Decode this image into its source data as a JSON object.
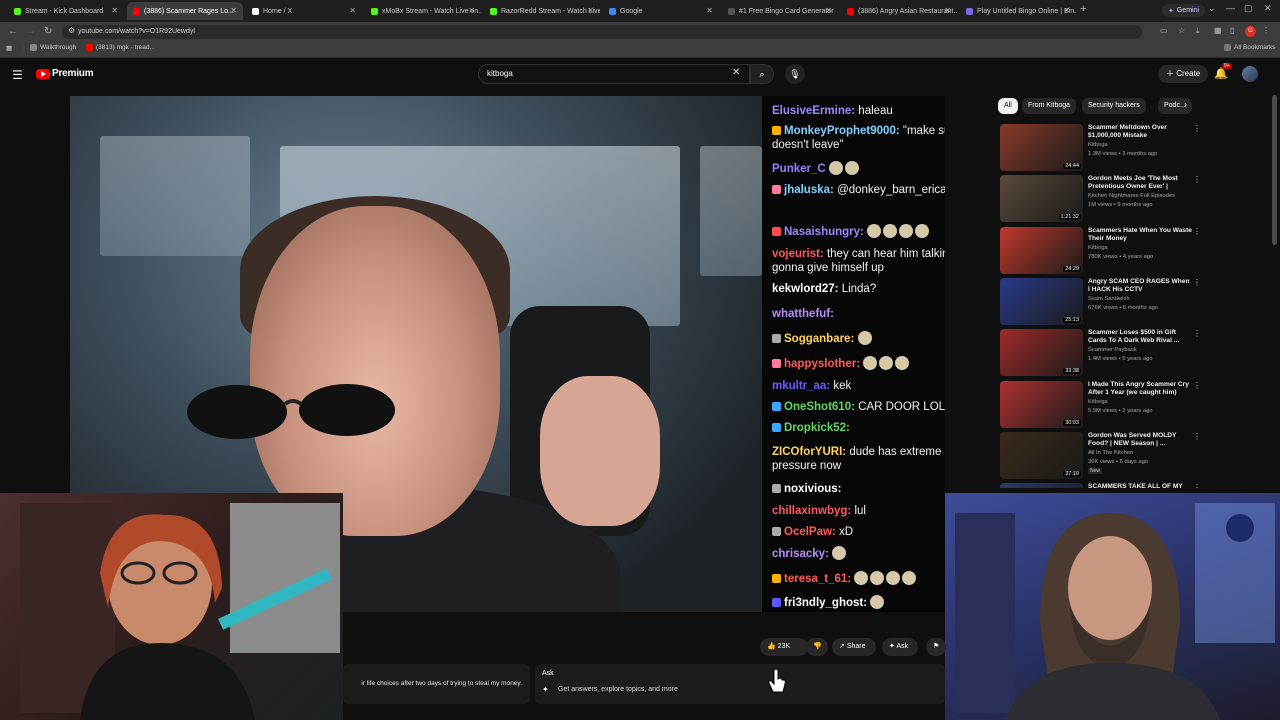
{
  "browser": {
    "tabs": [
      {
        "label": "Stream - Kick Dashboard",
        "color": "#53fc18",
        "active": false
      },
      {
        "label": "(3886) Scammer Rages Lo...",
        "color": "#ff0000",
        "active": true
      },
      {
        "label": "Home / X",
        "color": "#ffffff",
        "active": false
      },
      {
        "label": "xMoBx Stream - Watch Live on...",
        "color": "#53fc18",
        "active": false
      },
      {
        "label": "RazorRedd Stream - Watch Live...",
        "color": "#53fc18",
        "active": false
      },
      {
        "label": "Google",
        "color": "#4285f4",
        "active": false
      },
      {
        "label": "#1 Free Bingo Card Generator",
        "color": "#555555",
        "active": false
      },
      {
        "label": "(3886) Angry Asian Restaurant...",
        "color": "#ff0000",
        "active": false
      },
      {
        "label": "Play Untitled Bingo Online | Bin...",
        "color": "#7b68ee",
        "active": false
      }
    ],
    "new_tab": "+",
    "gemini_label": "Gemini",
    "url": "youtube.com/watch?v=O1R92Uewdyl",
    "bookmarks": [
      {
        "label": "Walkthrough",
        "color": "#888888"
      },
      {
        "label": "(3813) mgk - tread...",
        "color": "#ff0000"
      }
    ],
    "all_bookmarks": "All Bookmarks",
    "profile_badge": "G"
  },
  "youtube": {
    "premium_label": "Premium",
    "search_value": "kitboga",
    "create_label": "Create",
    "notif_badge": "9+",
    "chips": [
      "All",
      "From Kitboga",
      "Security hackers",
      "Podc..."
    ]
  },
  "chat": [
    {
      "user": "ElusiveErmine:",
      "msg": "haleau",
      "color": "#9b8bff",
      "badge": ""
    },
    {
      "user": "MonkeyProphet9000:",
      "msg": "\"make sure he doesn't leave\"",
      "color": "#7fd1ff",
      "badge": "#ffb000"
    },
    {
      "user": "Punker_C",
      "msg": "",
      "color": "#a07bff",
      "badge": "",
      "emotes": 2
    },
    {
      "user": "jhaluska:",
      "msg": "@donkey_barn_erica",
      "color": "#7fd1ff",
      "badge": "#ff7b9c"
    },
    {
      "user": "Nasaishungry:",
      "msg": "",
      "color": "#9b8bff",
      "badge": "#ff4d4d",
      "emotes": 4
    },
    {
      "user": "vojeurist:",
      "msg": "they can hear him talking, he's gonna give himself up",
      "color": "#ff5a5a",
      "badge": ""
    },
    {
      "user": "kekwlord27:",
      "msg": "Linda?",
      "color": "#ffffff",
      "badge": ""
    },
    {
      "user": "whatthefuf:",
      "msg": "",
      "color": "#b98cff",
      "badge": ""
    },
    {
      "user": "Sogganbare:",
      "msg": "",
      "color": "#ffd45a",
      "badge": "#aaaaaa",
      "emotes": 1
    },
    {
      "user": "happyslother:",
      "msg": "",
      "color": "#ff5a5a",
      "badge": "#ff7b9c",
      "emotes": 3
    },
    {
      "user": "mkultr_aa:",
      "msg": "kek",
      "color": "#6a5cff",
      "badge": ""
    },
    {
      "user": "OneShot610:",
      "msg": "CAR DOOR LOL",
      "color": "#5fd75f",
      "badge": "#3ea6ff"
    },
    {
      "user": "Dropkick52:",
      "msg": "",
      "color": "#5fd75f",
      "badge": "#3ea6ff"
    },
    {
      "user": "ZICOforYURI:",
      "msg": "dude has extreme blood pressure now",
      "color": "#ffd45a",
      "badge": ""
    },
    {
      "user": "noxivious:",
      "msg": "",
      "color": "#ffffff",
      "badge": "#aaaaaa"
    },
    {
      "user": "chillaxinwbyg:",
      "msg": "lul",
      "color": "#ff5a5a",
      "badge": ""
    },
    {
      "user": "OcelPaw:",
      "msg": "xD",
      "color": "#ff5a5a",
      "badge": "#aaaaaa"
    },
    {
      "user": "chrisacky:",
      "msg": "",
      "color": "#b98cff",
      "badge": "",
      "emotes": 1
    },
    {
      "user": "teresa_t_61:",
      "msg": "",
      "color": "#ff5a5a",
      "badge": "#ffb000",
      "emotes": 4
    },
    {
      "user": "fri3ndly_ghost:",
      "msg": "",
      "color": "#ffffff",
      "badge": "#5a5aff",
      "emotes": 1
    }
  ],
  "recommendations": [
    {
      "title": "Scammer Meltdown Over $1,000,000 Mistake",
      "channel": "Kitboga",
      "meta": "1.3M views • 3 months ago",
      "duration": "24:44",
      "thumb": "#8a3a2a"
    },
    {
      "title": "Gordon Meets Joe 'The Most Pretentious Owner Ever' | FULL...",
      "channel": "Kitchen Nightmares Full Episodes",
      "meta": "1M views • 9 months ago",
      "duration": "1:21:32",
      "thumb": "#5a4a3a"
    },
    {
      "title": "Scammers Hate When You Waste Their Money",
      "channel": "Kitboga",
      "meta": "780K views • 4 years ago",
      "duration": "24:29",
      "thumb": "#c0392b"
    },
    {
      "title": "Angry SCAM CEO RAGES When I HACK His CCTV",
      "channel": "Scam Sandwich",
      "meta": "676K views • 6 months ago",
      "duration": "25:13",
      "thumb": "#2a3a8a"
    },
    {
      "title": "Scammer Loses $500 in Gift Cards To A Dark Web Rival ...",
      "channel": "Scammer Payback",
      "meta": "1.4M views • 5 years ago",
      "duration": "33:38",
      "thumb": "#a02a2a"
    },
    {
      "title": "I Made This Angry Scammer Cry After 1 Year (we caught him)",
      "channel": "Kitboga",
      "meta": "5.5M views • 2 years ago",
      "duration": "30:03",
      "thumb": "#b03030"
    },
    {
      "title": "Gordon Was Served MOLDY Food? | NEW Season | ...",
      "channel": "All In The Kitchen",
      "meta": "36K views • 6 days ago",
      "duration": "37:10",
      "thumb": "#3a2a1a",
      "new": "New"
    },
    {
      "title": "SCAMMERS TAKE ALL OF MY",
      "channel": "",
      "meta": "",
      "duration": "",
      "thumb": "#2a3a6a"
    }
  ],
  "actions": {
    "like_count": "23K",
    "share_label": "Share",
    "ask_label": "Ask"
  },
  "description_snippet": "ir life choices after two days of trying to steal my money.",
  "ask_panel": {
    "title": "Ask",
    "placeholder": "Get answers, explore topics, and more"
  }
}
